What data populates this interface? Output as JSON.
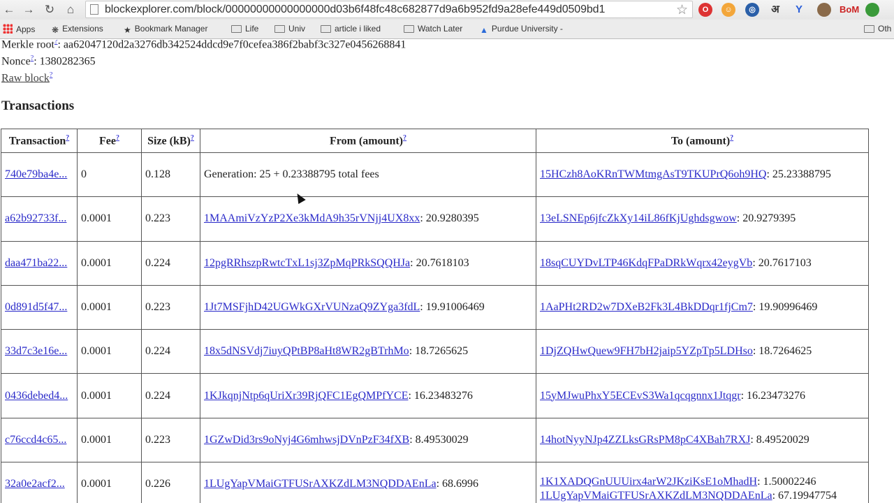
{
  "browser": {
    "url": "blockexplorer.com/block/00000000000000000d03b6f48fc48c682877d9a6b952fd9a28efe449d0509bd1",
    "extensions": [
      "O",
      "☺",
      "◎",
      "अ",
      "Y",
      "●",
      "BoM",
      "●"
    ],
    "bookmarks": [
      {
        "label": "Apps"
      },
      {
        "label": "Extensions"
      },
      {
        "label": "Bookmark Manager"
      },
      {
        "label": "Life"
      },
      {
        "label": "Univ"
      },
      {
        "label": "article i liked"
      },
      {
        "label": "Watch Later"
      },
      {
        "label": "Purdue University -"
      },
      {
        "label": "Oth"
      }
    ]
  },
  "block": {
    "merkle_label": "Merkle root",
    "merkle_value": ": aa62047120d2a3276db342524ddcd9e7f0cefea386f2babf3c327e0456268841",
    "nonce_label": "Nonce",
    "nonce_value": ": 1380282365",
    "raw_block": "Raw block",
    "help": "?"
  },
  "transactions": {
    "title": "Transactions",
    "headers": [
      "Transaction",
      "Fee",
      "Size (kB)",
      "From (amount)",
      "To (amount)"
    ],
    "rows": [
      {
        "tx": "740e79ba4e...",
        "fee": "0",
        "size": "0.128",
        "from_addr": "",
        "from_amt": "Generation: 25 + 0.23388795 total fees",
        "to": [
          {
            "addr": "15HCzh8AoKRnTWMtmgAsT9TKUPrQ6oh9HQ",
            "amt": ": 25.23388795"
          }
        ]
      },
      {
        "tx": "a62b92733f...",
        "fee": "0.0001",
        "size": "0.223",
        "from_addr": "1MAAmiVzYzP2Xe3kMdA9h35rVNjj4UX8xx",
        "from_amt": ": 20.9280395",
        "to": [
          {
            "addr": "13eLSNEp6jfcZkXy14iL86fKjUghdsgwow",
            "amt": ": 20.9279395"
          }
        ]
      },
      {
        "tx": "daa471ba22...",
        "fee": "0.0001",
        "size": "0.224",
        "from_addr": "12pgRRhszpRwtcTxL1sj3ZpMqPRkSQQHJa",
        "from_amt": ": 20.7618103",
        "to": [
          {
            "addr": "18sqCUYDvLTP46KdqFPaDRkWqrx42eygVb",
            "amt": ": 20.7617103"
          }
        ]
      },
      {
        "tx": "0d891d5f47...",
        "fee": "0.0001",
        "size": "0.223",
        "from_addr": "1Jt7MSFjhD42UGWkGXrVUNzaQ9ZYga3fdL",
        "from_amt": ": 19.91006469",
        "to": [
          {
            "addr": "1AaPHt2RD2w7DXeB2Fk3L4BkDDqr1fjCm7",
            "amt": ": 19.90996469"
          }
        ]
      },
      {
        "tx": "33d7c3e16e...",
        "fee": "0.0001",
        "size": "0.224",
        "from_addr": "18x5dNSVdj7iuyQPtBP8aHt8WR2gBTrhMo",
        "from_amt": ": 18.7265625",
        "to": [
          {
            "addr": "1DjZQHwQuew9FH7bH2jaip5YZpTp5LDHso",
            "amt": ": 18.7264625"
          }
        ]
      },
      {
        "tx": "0436debed4...",
        "fee": "0.0001",
        "size": "0.224",
        "from_addr": "1KJkqnjNtp6qUriXr39RjQFC1EgQMPfYCE",
        "from_amt": ": 16.23483276",
        "to": [
          {
            "addr": "15yMJwuPhxY5ECEvS3Wa1qcqgnnx1Jtqgr",
            "amt": ": 16.23473276"
          }
        ]
      },
      {
        "tx": "c76ccd4c65...",
        "fee": "0.0001",
        "size": "0.223",
        "from_addr": "1GZwDid3rs9oNyj4G6mhwsjDVnPzF34fXB",
        "from_amt": ": 8.49530029",
        "to": [
          {
            "addr": "14hotNyyNJp4ZZLksGRsPM8pC4XBah7RXJ",
            "amt": ": 8.49520029"
          }
        ]
      },
      {
        "tx": "32a0e2acf2...",
        "fee": "0.0001",
        "size": "0.226",
        "from_addr": "1LUgYapVMaiGTFUSrAXKZdLM3NQDDAEnLa",
        "from_amt": ": 68.6996",
        "to": [
          {
            "addr": "1K1XADQGnUUUirx4arW2JKziKsE1oMhadH",
            "amt": ": 1.50002246"
          },
          {
            "addr": "1LUgYapVMaiGTFUSrAXKZdLM3NQDDAEnLa",
            "amt": ": 67.19947754"
          }
        ]
      }
    ]
  }
}
